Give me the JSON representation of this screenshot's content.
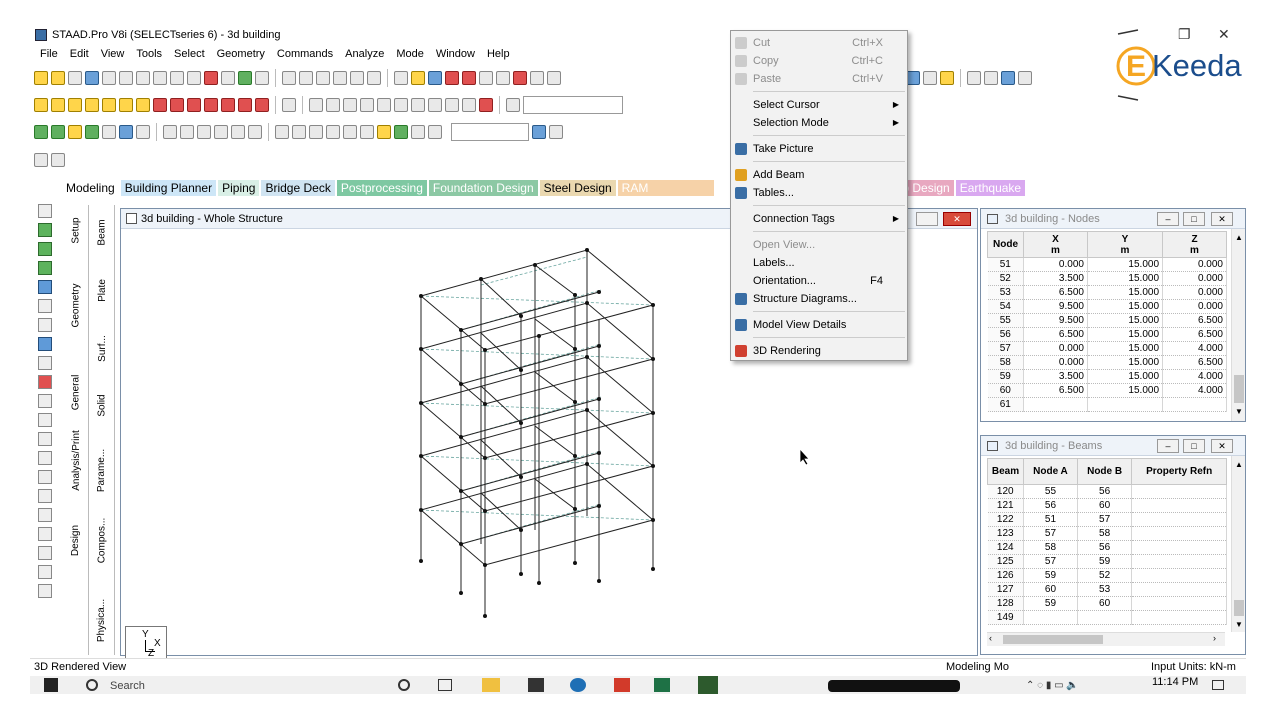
{
  "window": {
    "title": "STAAD.Pro V8i (SELECTseries 6) - 3d building"
  },
  "brand": {
    "logo_text": "Keeda"
  },
  "menubar": [
    "File",
    "Edit",
    "View",
    "Tools",
    "Select",
    "Geometry",
    "Commands",
    "Analyze",
    "Mode",
    "Window",
    "Help"
  ],
  "page_tabs": [
    "Modeling",
    "Building Planner",
    "Piping",
    "Bridge Deck",
    "Postprocessing",
    "Foundation Design",
    "Steel Design",
    "RAM Connection",
    "ab Design",
    "Earthquake"
  ],
  "left_panel_tabs_a": [
    "Setup",
    "Geometry",
    "General",
    "Analysis/Print",
    "Design"
  ],
  "left_panel_tabs_b": [
    "Beam",
    "Plate",
    "Surf...",
    "Solid",
    "Parame...",
    "Compos...",
    "Physica..."
  ],
  "main_window": {
    "title": "3d building - Whole Structure",
    "axis_labels": {
      "y": "Y",
      "x": "X",
      "z": "Z"
    }
  },
  "nodes_window": {
    "title": "3d building - Nodes",
    "headers": [
      "Node",
      "X",
      "Y",
      "Z"
    ],
    "units": [
      "",
      "m",
      "m",
      "m"
    ],
    "rows": [
      [
        "51",
        "0.000",
        "15.000",
        "0.000"
      ],
      [
        "52",
        "3.500",
        "15.000",
        "0.000"
      ],
      [
        "53",
        "6.500",
        "15.000",
        "0.000"
      ],
      [
        "54",
        "9.500",
        "15.000",
        "0.000"
      ],
      [
        "55",
        "9.500",
        "15.000",
        "6.500"
      ],
      [
        "56",
        "6.500",
        "15.000",
        "6.500"
      ],
      [
        "57",
        "0.000",
        "15.000",
        "4.000"
      ],
      [
        "58",
        "0.000",
        "15.000",
        "6.500"
      ],
      [
        "59",
        "3.500",
        "15.000",
        "4.000"
      ],
      [
        "60",
        "6.500",
        "15.000",
        "4.000"
      ],
      [
        "61",
        "",
        "",
        ""
      ]
    ]
  },
  "beams_window": {
    "title": "3d building - Beams",
    "headers": [
      "Beam",
      "Node A",
      "Node B",
      "Property Refn"
    ],
    "rows": [
      [
        "120",
        "55",
        "56",
        ""
      ],
      [
        "121",
        "56",
        "60",
        ""
      ],
      [
        "122",
        "51",
        "57",
        ""
      ],
      [
        "123",
        "57",
        "58",
        ""
      ],
      [
        "124",
        "58",
        "56",
        ""
      ],
      [
        "125",
        "57",
        "59",
        ""
      ],
      [
        "126",
        "59",
        "52",
        ""
      ],
      [
        "127",
        "60",
        "53",
        ""
      ],
      [
        "128",
        "59",
        "60",
        ""
      ],
      [
        "149",
        "",
        "",
        ""
      ]
    ]
  },
  "context_menu": {
    "items": [
      {
        "label": "Cut",
        "shortcut": "Ctrl+X",
        "disabled": true
      },
      {
        "label": "Copy",
        "shortcut": "Ctrl+C",
        "disabled": true
      },
      {
        "label": "Paste",
        "shortcut": "Ctrl+V",
        "disabled": true
      },
      {
        "label": "Select Cursor",
        "submenu": true
      },
      {
        "label": "Selection Mode",
        "submenu": true
      },
      {
        "label": "Take Picture"
      },
      {
        "label": "Add Beam"
      },
      {
        "label": "Tables..."
      },
      {
        "label": "Connection Tags",
        "submenu": true
      },
      {
        "label": "Open View...",
        "disabled": true
      },
      {
        "label": "Labels..."
      },
      {
        "label": "Orientation...",
        "shortcut": "F4"
      },
      {
        "label": "Structure Diagrams..."
      },
      {
        "label": "Model View Details"
      },
      {
        "label": "3D Rendering"
      }
    ]
  },
  "statusbar": {
    "left": "3D Rendered View",
    "mode": "Modeling Mo",
    "units": "Input Units:  kN-m"
  },
  "taskbar": {
    "search": "Search",
    "time": "11:14 PM"
  },
  "colors": {
    "accent": "#3a6ea5",
    "model_line": "#222222",
    "grid_line": "#6aa6a0"
  }
}
